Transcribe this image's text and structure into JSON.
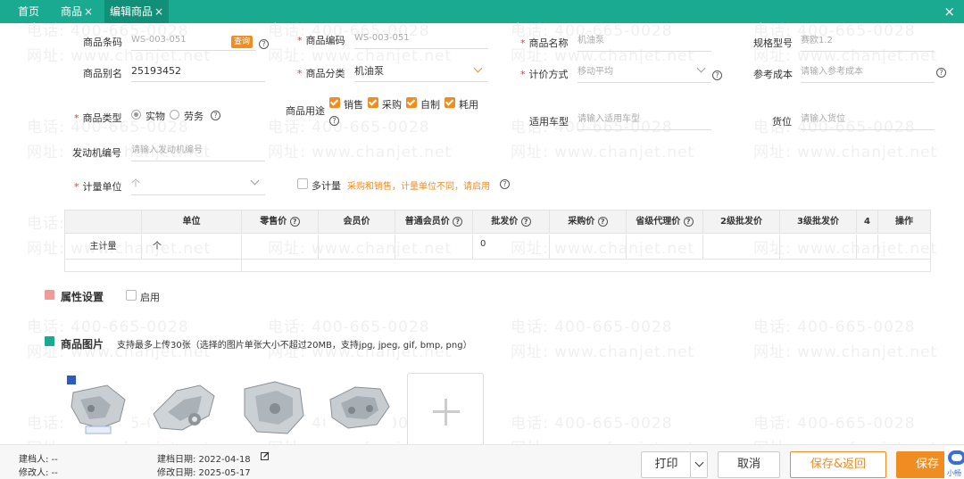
{
  "tabs": [
    {
      "label": "首页",
      "close": ""
    },
    {
      "label": "商品",
      "close": "×"
    },
    {
      "label": "编辑商品",
      "close": "×"
    }
  ],
  "close_icon": "×",
  "watermark": {
    "phone": "电话: 400-665-0028",
    "site": "网址: www.chanjet.net"
  },
  "form": {
    "barcode": {
      "label": "商品条码",
      "value": "WS-003-051",
      "query": "查询"
    },
    "code": {
      "label": "商品编码",
      "value": "WS-003-051"
    },
    "name": {
      "label": "商品名称",
      "value": "机油泵"
    },
    "spec": {
      "label": "规格型号",
      "value": "赛欧1.2"
    },
    "alias": {
      "label": "商品别名",
      "value": "25193452"
    },
    "category": {
      "label": "商品分类",
      "value": "机油泵"
    },
    "pricing": {
      "label": "计价方式",
      "value": "移动平均"
    },
    "ref_cost": {
      "label": "参考成本",
      "placeholder": "请输入参考成本"
    },
    "type": {
      "label": "商品类型",
      "opt1": "实物",
      "opt2": "劳务"
    },
    "usage": {
      "label": "商品用途",
      "opt1": "销售",
      "opt2": "采购",
      "opt3": "自制",
      "opt4": "耗用"
    },
    "model": {
      "label": "适用车型",
      "placeholder": "请输入适用车型"
    },
    "location": {
      "label": "货位",
      "placeholder": "请输入货位"
    },
    "engine": {
      "label": "发动机编号",
      "placeholder": "请输入发动机编号"
    },
    "unit": {
      "label": "计量单位",
      "value": "个"
    },
    "multi": {
      "label": "多计量",
      "hint": "采购和销售，计量单位不同，请启用"
    }
  },
  "table": {
    "headers": [
      "",
      "单位",
      "零售价",
      "会员价",
      "普通会员价",
      "批发价",
      "采购价",
      "省级代理价",
      "2级批发价",
      "3级批发价",
      "4",
      "操作"
    ],
    "row": {
      "label": "主计量",
      "unit": "个",
      "wholesale": "0"
    }
  },
  "attr_section": {
    "title": "属性设置",
    "enable": "启用"
  },
  "image_section": {
    "title": "商品图片",
    "note": "支持最多上传30张（选择的图片单张大小不超过20MB，支持jpg, jpeg, gif, bmp, png）"
  },
  "footer": {
    "creator": "建档人: --",
    "modifier": "修改人: --",
    "create_date": "建档日期: 2022-04-18",
    "modify_date": "修改日期: 2025-05-17",
    "print": "打印",
    "cancel": "取消",
    "save_return": "保存&返回",
    "save": "保存",
    "chat": "小畅"
  },
  "colors": {
    "header": "#1aaa91",
    "accent": "#f08d22",
    "required": "#e4393c"
  }
}
